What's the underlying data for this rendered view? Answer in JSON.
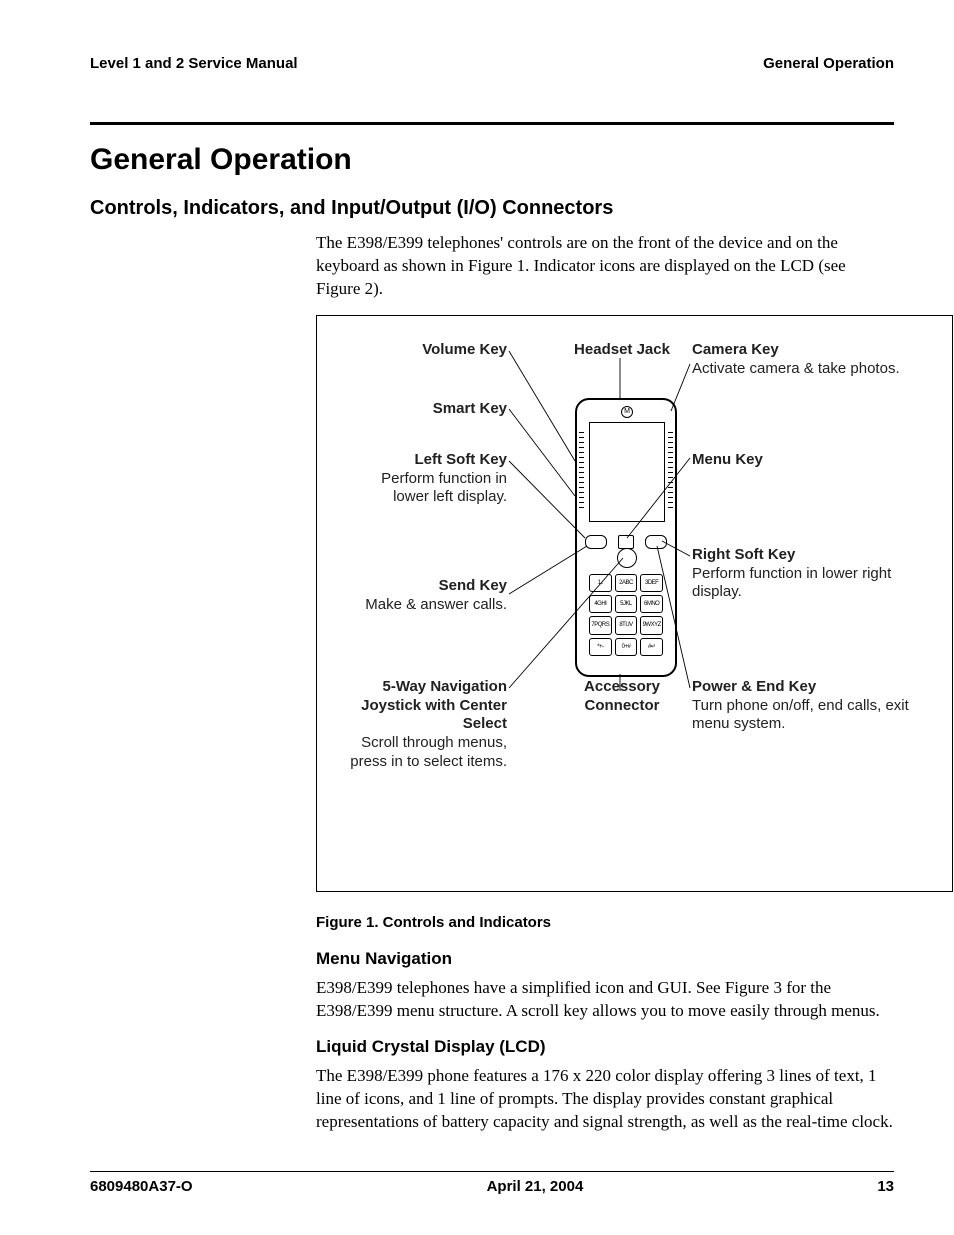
{
  "header": {
    "left": "Level 1 and 2 Service Manual",
    "right": "General Operation"
  },
  "title": "General Operation",
  "section": "Controls, Indicators, and Input/Output (I/O) Connectors",
  "intro": "The E398/E399 telephones' controls are on the front of the device and on the keyboard as shown in Figure 1. Indicator icons are displayed on the LCD (see Figure 2).",
  "fig": {
    "caption": "Figure 1. Controls and Indicators",
    "labels": {
      "volume_key": {
        "title": "Volume Key",
        "desc": ""
      },
      "headset_jack": {
        "title": "Headset Jack",
        "desc": ""
      },
      "camera_key": {
        "title": "Camera Key",
        "desc": "Activate camera & take photos."
      },
      "smart_key": {
        "title": "Smart Key",
        "desc": ""
      },
      "left_soft": {
        "title": "Left Soft Key",
        "desc": "Perform function in lower left display."
      },
      "menu_key": {
        "title": "Menu Key",
        "desc": ""
      },
      "send_key": {
        "title": "Send Key",
        "desc": "Make & answer calls."
      },
      "right_soft": {
        "title": "Right Soft Key",
        "desc": "Perform function in lower right display."
      },
      "nav": {
        "title": "5-Way Navigation Joystick with Center Select",
        "desc": "Scroll through menus, press in to select items."
      },
      "accessory": {
        "title": "Accessory Connector",
        "desc": ""
      },
      "power_end": {
        "title": "Power & End Key",
        "desc": "Turn phone on/off, end calls, exit menu system."
      }
    },
    "keypad": [
      "1..",
      "2ABC",
      "3DEF",
      "4GHI",
      "5JKL",
      "6MNO",
      "7PQRS",
      "8TUV",
      "9WXYZ",
      "*+-",
      "0+#",
      "#↵"
    ]
  },
  "subs": {
    "menu_nav": {
      "heading": "Menu Navigation",
      "body": "E398/E399 telephones have a simplified icon and GUI. See Figure 3 for the E398/E399 menu structure. A scroll key allows you to move easily through menus."
    },
    "lcd": {
      "heading": "Liquid Crystal Display (LCD)",
      "body": "The E398/E399 phone features a 176 x 220 color display offering 3 lines of text, 1 line of icons, and 1 line of prompts. The display provides constant graphical representations of battery capacity and signal strength, as well as the real-time clock."
    }
  },
  "footer": {
    "left": "6809480A37-O",
    "center": "April 21, 2004",
    "right": "13"
  }
}
